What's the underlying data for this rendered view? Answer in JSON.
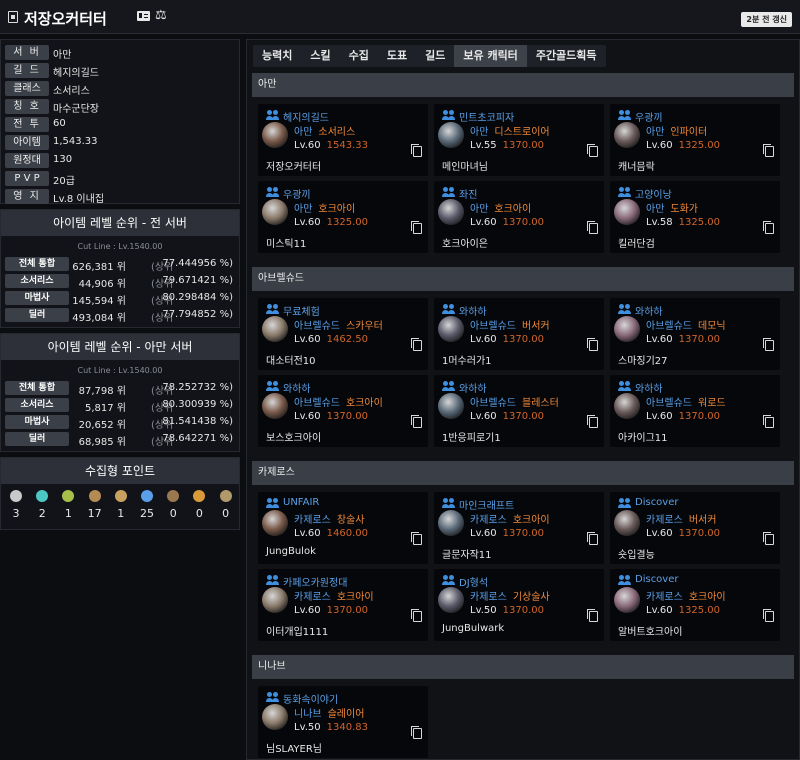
{
  "header": {
    "title": "저장오커터터",
    "updated": "2분 전 갱신"
  },
  "profile": [
    {
      "label": "서 버",
      "value": "아만"
    },
    {
      "label": "길 드",
      "value": "헤지의길드"
    },
    {
      "label": "클래스",
      "value": "소서리스"
    },
    {
      "label": "칭 호",
      "value": "마수군단장"
    },
    {
      "label": "전 투",
      "value": "60"
    },
    {
      "label": "아이템",
      "value": "1,543.33"
    },
    {
      "label": "원정대",
      "value": "130"
    },
    {
      "label": "P V P",
      "value": "20급"
    },
    {
      "label": "영 지",
      "value": "Lv.8 이내집"
    }
  ],
  "rank_all": {
    "title": "아이템 레벨 순위 - 전 서버",
    "cutline": "Cut Line : Lv.1540.00",
    "rows": [
      {
        "label": "전체 통합",
        "pos": "626,381 위",
        "pct": "77.444956 %)"
      },
      {
        "label": "소서리스",
        "pos": "44,906 위",
        "pct": "79.671421 %)"
      },
      {
        "label": "마법사",
        "pos": "145,594 위",
        "pct": "80.298484 %)"
      },
      {
        "label": "딜러",
        "pos": "493,084 위",
        "pct": "77.794852 %)"
      }
    ]
  },
  "rank_server": {
    "title": "아이템 레벨 순위 - 아만 서버",
    "cutline": "Cut Line : Lv.1540.00",
    "rows": [
      {
        "label": "전체 통합",
        "pos": "87,798 위",
        "pct": "78.252732 %)"
      },
      {
        "label": "소서리스",
        "pos": "5,817 위",
        "pct": "80.300939 %)"
      },
      {
        "label": "마법사",
        "pos": "20,652 위",
        "pct": "81.541438 %)"
      },
      {
        "label": "딜러",
        "pos": "68,985 위",
        "pct": "78.642271 %)"
      }
    ]
  },
  "rank_sep": "(상위",
  "collect": {
    "title": "수집형 포인트",
    "items": [
      {
        "icon": "seed-icon",
        "color": "#c9c9c9",
        "count": "3"
      },
      {
        "icon": "island-heart-icon",
        "color": "#4cc7c4",
        "count": "2"
      },
      {
        "icon": "giant-heart-icon",
        "color": "#a8c04a",
        "count": "1"
      },
      {
        "icon": "artwork-icon",
        "color": "#b48a55",
        "count": "17"
      },
      {
        "icon": "voyage-icon",
        "color": "#c8a060",
        "count": "1"
      },
      {
        "icon": "world-tree-leaf-icon",
        "color": "#5aa0e8",
        "count": "25"
      },
      {
        "icon": "ignea-icon",
        "color": "#9a7850",
        "count": "0"
      },
      {
        "icon": "orpheus-star-icon",
        "color": "#d99a3a",
        "count": "0"
      },
      {
        "icon": "medal-icon",
        "color": "#b09a6a",
        "count": "0"
      }
    ]
  },
  "tabs": [
    "능력치",
    "스킬",
    "수집",
    "도표",
    "길드",
    "보유 캐릭터",
    "주간골드획득"
  ],
  "active_tab": "보유 캐릭터",
  "servers": [
    {
      "name": "아만",
      "characters": [
        {
          "guild": "헤지의길드",
          "server": "아만",
          "cls": "소서리스",
          "level": "Lv.60",
          "ilvl": "1543.33",
          "name": "저장오커터터"
        },
        {
          "guild": "민트초코피자",
          "server": "아만",
          "cls": "디스트로이어",
          "level": "Lv.55",
          "ilvl": "1370.00",
          "name": "메인마녀님"
        },
        {
          "guild": "우광끼",
          "server": "아만",
          "cls": "인파이터",
          "level": "Lv.60",
          "ilvl": "1325.00",
          "name": "캐너믐락"
        },
        {
          "guild": "우광끼",
          "server": "아만",
          "cls": "호크아이",
          "level": "Lv.60",
          "ilvl": "1325.00",
          "name": "미스틱11"
        },
        {
          "guild": "좌진",
          "server": "아만",
          "cls": "호크아이",
          "level": "Lv.60",
          "ilvl": "1370.00",
          "name": "호크아이은"
        },
        {
          "guild": "고양이낭",
          "server": "아만",
          "cls": "도화가",
          "level": "Lv.58",
          "ilvl": "1325.00",
          "name": "킬러단검"
        }
      ]
    },
    {
      "name": "아브렐슈드",
      "characters": [
        {
          "guild": "무료체험",
          "server": "아브렐슈드",
          "cls": "스카우터",
          "level": "Lv.60",
          "ilvl": "1462.50",
          "name": "대소터전10"
        },
        {
          "guild": "와하하",
          "server": "아브렐슈드",
          "cls": "버서커",
          "level": "Lv.60",
          "ilvl": "1370.00",
          "name": "1머수러가1"
        },
        {
          "guild": "와하하",
          "server": "아브렐슈드",
          "cls": "데모닉",
          "level": "Lv.60",
          "ilvl": "1370.00",
          "name": "스마징기27"
        },
        {
          "guild": "와하하",
          "server": "아브렐슈드",
          "cls": "호크아이",
          "level": "Lv.60",
          "ilvl": "1370.00",
          "name": "보스호크아이"
        },
        {
          "guild": "와하하",
          "server": "아브렐슈드",
          "cls": "블레스터",
          "level": "Lv.60",
          "ilvl": "1370.00",
          "name": "1반응피로기1"
        },
        {
          "guild": "와하하",
          "server": "아브렐슈드",
          "cls": "워로드",
          "level": "Lv.60",
          "ilvl": "1370.00",
          "name": "아카이그11"
        }
      ]
    },
    {
      "name": "카제로스",
      "characters": [
        {
          "guild": "UNFAIR",
          "server": "카제로스",
          "cls": "창술사",
          "level": "Lv.60",
          "ilvl": "1460.00",
          "name": "JungBulok"
        },
        {
          "guild": "마인크래프트",
          "server": "카제로스",
          "cls": "호크아이",
          "level": "Lv.60",
          "ilvl": "1370.00",
          "name": "글문자작11"
        },
        {
          "guild": "Discover",
          "server": "카제로스",
          "cls": "버서커",
          "level": "Lv.60",
          "ilvl": "1370.00",
          "name": "숏입결능"
        },
        {
          "guild": "카페오카원정대",
          "server": "카제로스",
          "cls": "호크아이",
          "level": "Lv.60",
          "ilvl": "1370.00",
          "name": "이터개입1111"
        },
        {
          "guild": "DJ형석",
          "server": "카제로스",
          "cls": "기상술사",
          "level": "Lv.50",
          "ilvl": "1370.00",
          "name": "JungBulwark"
        },
        {
          "guild": "Discover",
          "server": "카제로스",
          "cls": "호크아이",
          "level": "Lv.60",
          "ilvl": "1325.00",
          "name": "알버트호크아이"
        }
      ]
    },
    {
      "name": "니나브",
      "characters": [
        {
          "guild": "동화속이야기",
          "server": "니나브",
          "cls": "슬레이어",
          "level": "Lv.50",
          "ilvl": "1340.83",
          "name": "님SLAYER님"
        }
      ]
    }
  ],
  "colors": {
    "accent_blue": "#5aa0e8",
    "class_orange": "#f08a3a",
    "ilvl_orange": "#d2642a",
    "bar_gray": "#3a3e47"
  }
}
